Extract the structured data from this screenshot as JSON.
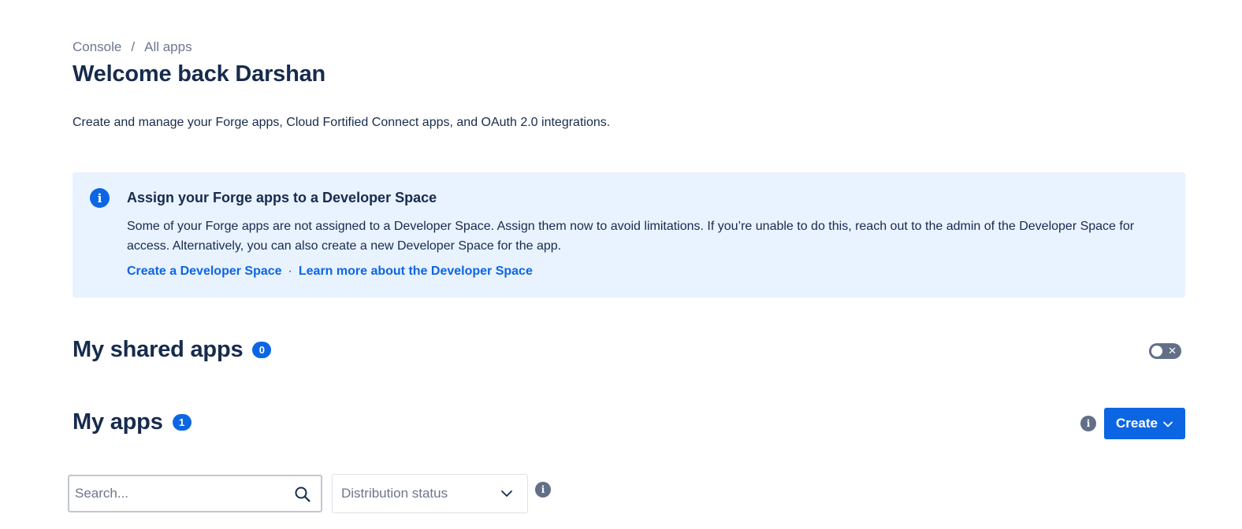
{
  "breadcrumb": {
    "items": [
      "Console",
      "All apps"
    ],
    "separator": "/"
  },
  "header": {
    "title": "Welcome back Darshan",
    "description": "Create and manage your Forge apps, Cloud Fortified Connect apps, and OAuth 2.0 integrations."
  },
  "banner": {
    "icon": "info-icon",
    "title": "Assign your Forge apps to a Developer Space",
    "body": "Some of your Forge apps are not assigned to a Developer Space. Assign them now to avoid limitations. If you’re unable to do this, reach out to the admin of the Developer Space for access. Alternatively, you can also create a new Developer Space for the app.",
    "links": [
      "Create a Developer Space",
      "Learn more about the Developer Space"
    ],
    "link_separator": "·"
  },
  "shared_apps": {
    "title": "My shared apps",
    "count": "0",
    "toggle_on": false
  },
  "my_apps": {
    "title": "My apps",
    "count": "1",
    "create_label": "Create"
  },
  "filters": {
    "search_placeholder": "Search...",
    "distribution_status_label": "Distribution status"
  },
  "colors": {
    "primary": "#0c66e4",
    "text": "#172b4d",
    "subtle_text": "#6b778c",
    "banner_bg": "#e9f2ff",
    "toggle_off": "#626f86"
  }
}
